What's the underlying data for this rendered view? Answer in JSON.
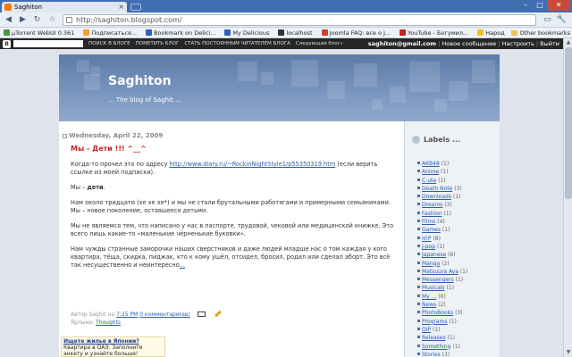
{
  "browser": {
    "tab_title": "Saghiton",
    "tab_close": "×",
    "url": "http://saghiton.blogspot.com/",
    "win_min": "–",
    "win_max": "□",
    "win_close": "✕",
    "nav_back": "◀",
    "nav_forward": "▶",
    "nav_reload": "↻",
    "nav_star": "☆",
    "page_menu": "▭",
    "tools_menu": "🔧"
  },
  "bookmarks": {
    "items": [
      {
        "label": "µTorrent WebUI 0.361",
        "color": "#4a9a3a"
      },
      {
        "label": "Подписаться...",
        "color": "#f0a030"
      },
      {
        "label": "Bookmark on Delici...",
        "color": "#3060c0"
      },
      {
        "label": "My Delicious",
        "color": "#3060c0"
      },
      {
        "label": "localhost",
        "color": "#333333"
      },
      {
        "label": "Joomla FAQ: все о J...",
        "color": "#d04030"
      },
      {
        "label": "YouTube - Богумил...",
        "color": "#cc2020"
      },
      {
        "label": "Народ",
        "color": "#f0c020"
      },
      {
        "label": "www.parapa.ru",
        "color": "#7a7a7a"
      }
    ],
    "other": "Other bookmarks"
  },
  "navbar": {
    "logo": "B",
    "search_blog": "ПОИСК В БЛОГЕ",
    "flag_blog": "ПОМЕТИТЬ БЛОГ",
    "follow": "СТАТЬ ПОСТОЯННЫМ ЧИТАТЕЛЕМ БЛОГА",
    "next_blog": "Следующий блог»",
    "email": "saghiton@gmail.com",
    "new_post": "Новое сообщение",
    "settings": "Настроить",
    "signout": "Выйти"
  },
  "blog": {
    "title": "Saghiton",
    "tagline": "... The blog of Saghit ..."
  },
  "post": {
    "date": "Wednesday, April 22, 2009",
    "title": "Мы - Дети !!! ^__^",
    "p1_before": "Когда-то прочел это по адресу ",
    "p1_link": "http://www.diary.ru/~RockinNightStyle1/p55350319.htm",
    "p1_after": " (если верить ссылке из моей подписки).",
    "p2_before": "Мы – ",
    "p2_bold": "дети",
    "p2_after": ".",
    "p3": "Нам около тридцати (хе хе хе*) и мы не стали брутальными работягами и примерными семьянинами. Мы – новое поколение, оставшееся детьми.",
    "p4": "Мы не являемся тем, что написано у нас в паспорте, трудовой, чековой или медицинской книжке. Это всего лишь какие-то «маленькие чёрненькие буковки».",
    "p5_text": "Нам чужды странные заморочки наших сверстников и даже людей младше нас о том каждая у кого квартира, тёща, скидка, пиджак, кто к кому ушёл, отсидел, бросил, родил или сделал аборт. Это всё так несущественно и неинтересно",
    "p5_link": "...",
    "author_prefix": "Автор Saghit на",
    "time": "7:25 PM",
    "comments": "0 комментари(ев)",
    "labels_prefix": "Ярлыки:",
    "labels_link": "Thoughts"
  },
  "ad": {
    "title": "Ищете жилье в Японии?",
    "text": "Квартира в ОАЭ. Заполните анкету и узнайте больше!"
  },
  "sidebar": {
    "heading": "Labels ...",
    "labels": [
      {
        "name": "AKB48",
        "count": "(1)"
      },
      {
        "name": "Anime",
        "count": "(1)"
      },
      {
        "name": "C-ute",
        "count": "(1)"
      },
      {
        "name": "Death Note",
        "count": "(3)"
      },
      {
        "name": "Downloads",
        "count": "(1)"
      },
      {
        "name": "Dreams",
        "count": "(3)"
      },
      {
        "name": "Fashion",
        "count": "(1)"
      },
      {
        "name": "Films",
        "count": "(4)"
      },
      {
        "name": "Games",
        "count": "(1)"
      },
      {
        "name": "H!P",
        "count": "(8)"
      },
      {
        "name": "J-pop",
        "count": "(1)"
      },
      {
        "name": "Japanese",
        "count": "(6)"
      },
      {
        "name": "Manga",
        "count": "(2)"
      },
      {
        "name": "Matsuura Aya",
        "count": "(1)"
      },
      {
        "name": "Messengers",
        "count": "(1)"
      },
      {
        "name": "Musicals",
        "count": "(1)"
      },
      {
        "name": "My ...",
        "count": "(6)"
      },
      {
        "name": "News",
        "count": "(2)"
      },
      {
        "name": "PhotoBooks",
        "count": "(3)"
      },
      {
        "name": "Programs",
        "count": "(1)"
      },
      {
        "name": "OIP",
        "count": "(1)"
      },
      {
        "name": "Releases",
        "count": "(1)"
      },
      {
        "name": "Something",
        "count": "(1)"
      },
      {
        "name": "Stories",
        "count": "(3)"
      }
    ]
  }
}
